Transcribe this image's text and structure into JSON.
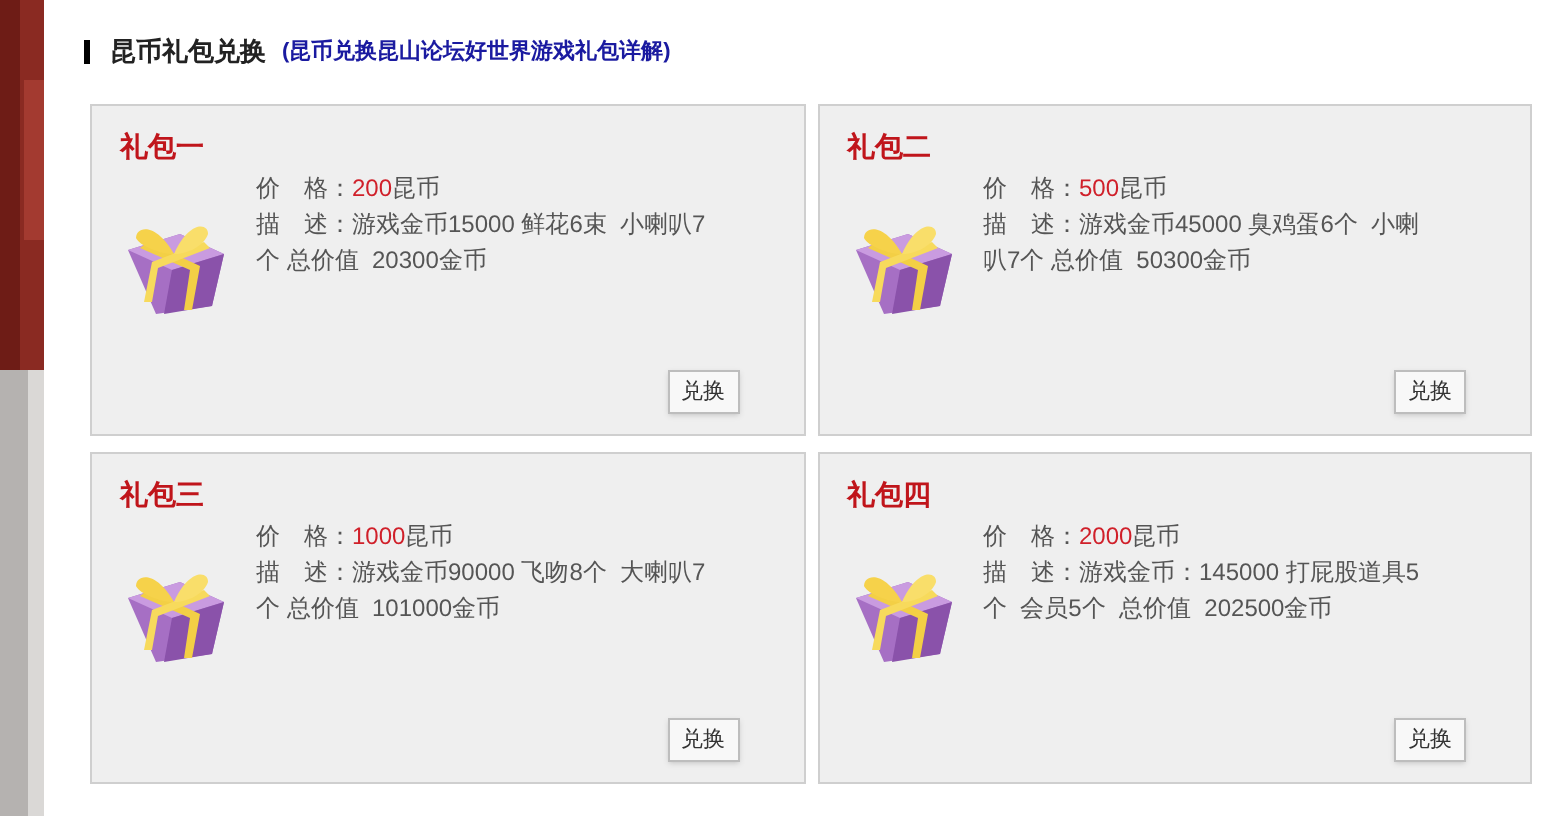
{
  "header": {
    "title": "昆币礼包兑换",
    "subtitle": "(昆币兑换昆山论坛好世界游戏礼包详解)"
  },
  "packages": [
    {
      "name": "礼包一",
      "price_label": "价　格：",
      "price": "200",
      "price_unit": "昆币",
      "description": "描　述：游戏金币15000 鲜花6束  小喇叭7个 总价值  20300金币",
      "button": "兑换"
    },
    {
      "name": "礼包二",
      "price_label": "价　格：",
      "price": "500",
      "price_unit": "昆币",
      "description": "描　述：游戏金币45000 臭鸡蛋6个  小喇叭7个 总价值  50300金币",
      "button": "兑换"
    },
    {
      "name": "礼包三",
      "price_label": "价　格：",
      "price": "1000",
      "price_unit": "昆币",
      "description": "描　述：游戏金币90000 飞吻8个  大喇叭7个 总价值  101000金币",
      "button": "兑换"
    },
    {
      "name": "礼包四",
      "price_label": "价　格：",
      "price": "2000",
      "price_unit": "昆币",
      "description": "描　述：游戏金币：145000 打屁股道具5个  会员5个  总价值  202500金币",
      "button": "兑换"
    }
  ]
}
